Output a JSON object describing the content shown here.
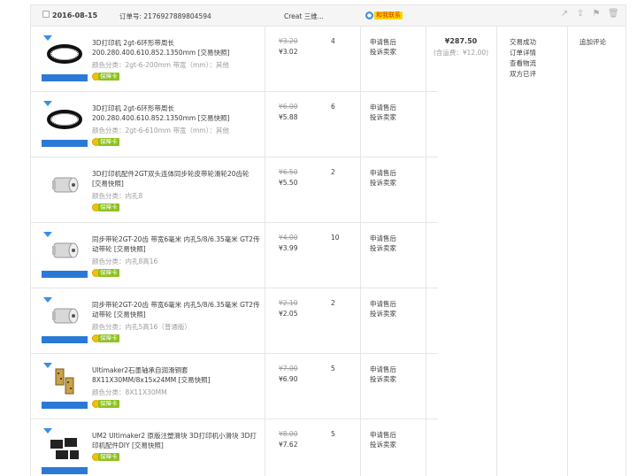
{
  "order": {
    "date": "2016-08-15",
    "number_label": "订单号: 2176927889804594",
    "shop": "Creat 三维...",
    "contact_label": "和我联系",
    "total": "¥287.50",
    "shipping": "(含运费：¥12.00)",
    "status_lines": [
      "交易成功",
      "订单详情",
      "查看物流",
      "双方已评"
    ],
    "review_label": "追加评论",
    "header_icons": [
      "share-icon",
      "upload-icon",
      "flag-icon",
      "trash-icon"
    ]
  },
  "items": [
    {
      "title": "3D打印机 2gt-6环形带周长200.280.400.610.852.1350mm [交易快照]",
      "sku": "颜色分类：2gt-6-200mm   带宽（mm）：其他",
      "badge": "保障卡",
      "orig_price": "¥3.20",
      "price": "¥3.02",
      "qty": "4",
      "actions": [
        "申请售后",
        "投诉卖家"
      ]
    },
    {
      "title": "3D打印机 2gt-6环形带周长200.280.400.610.852.1350mm [交易快照]",
      "sku": "颜色分类：2gt-6-610mm   带宽（mm）：其他",
      "badge": "保障卡",
      "orig_price": "¥6.00",
      "price": "¥5.88",
      "qty": "6",
      "actions": [
        "申请售后",
        "投诉卖家"
      ]
    },
    {
      "title": "3D打印机配件2GT双头连体同步轮皮带轮滑轮20齿轮 [交易快照]",
      "sku": "颜色分类：内孔8",
      "badge": "保障卡",
      "orig_price": "¥6.50",
      "price": "¥5.50",
      "qty": "2",
      "actions": [
        "申请售后",
        "投诉卖家"
      ]
    },
    {
      "title": "同步带轮2GT-20齿 带宽6毫米 内孔5/8/6.35毫米 GT2传动带轮 [交易快照]",
      "sku": "颜色分类：内孔8高16",
      "badge": "保障卡",
      "orig_price": "¥4.00",
      "price": "¥3.99",
      "qty": "10",
      "actions": [
        "申请售后",
        "投诉卖家"
      ]
    },
    {
      "title": "同步带轮2GT-20齿 带宽6毫米 内孔5/8/6.35毫米 GT2传动带轮 [交易快照]",
      "sku": "颜色分类：内孔5高16（普通版）",
      "badge": "保障卡",
      "orig_price": "¥2.10",
      "price": "¥2.05",
      "qty": "2",
      "actions": [
        "申请售后",
        "投诉卖家"
      ]
    },
    {
      "title": "Ultimaker2石墨轴承自润滑铜套 8X11X30MM/8x15x24MM [交易快照]",
      "sku": "颜色分类：8X11X30MM",
      "badge": "保障卡",
      "orig_price": "¥7.00",
      "price": "¥6.90",
      "qty": "5",
      "actions": [
        "申请售后",
        "投诉卖家"
      ]
    },
    {
      "title": "UM2 Ultimaker2 原版注塑滑块 3D打印机小滑块 3D打印机配件DIY [交易快照]",
      "sku": "",
      "badge": "保障卡",
      "orig_price": "¥8.00",
      "price": "¥7.62",
      "qty": "5",
      "actions": [
        "申请售后",
        "投诉卖家"
      ]
    }
  ]
}
